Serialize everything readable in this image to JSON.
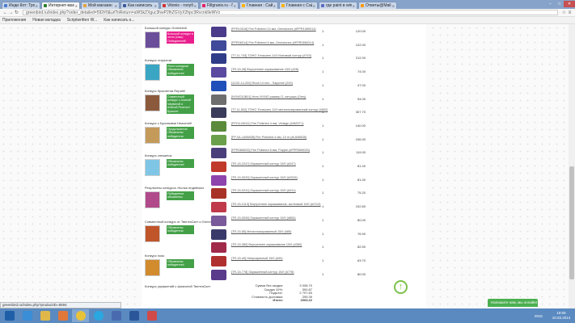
{
  "browser": {
    "tabs": [
      {
        "title": "Инди Кот: Тро",
        "color": "#4a7bd0",
        "active": false
      },
      {
        "title": "Интернет-магаз",
        "color": "#2e7d32",
        "active": true
      },
      {
        "title": "Мой магазин",
        "color": "#e6a23c",
        "active": false
      },
      {
        "title": "Как написать по",
        "color": "#3b5998",
        "active": false
      },
      {
        "title": "Vitonis - голубое",
        "color": "#d32f2f",
        "active": false
      },
      {
        "title": "Fillgranis.ru - Прог",
        "color": "#e91e63",
        "active": false
      },
      {
        "title": "Главная : Сайт ма",
        "color": "#ffb300",
        "active": false
      },
      {
        "title": "Главная с Сайт ма",
        "color": "#ffb300",
        "active": false
      },
      {
        "title": "где paint в windo",
        "color": "#5c6bc0",
        "active": false
      },
      {
        "title": "Ответы@Mail.Ru",
        "color": "#ff9800",
        "active": false
      }
    ],
    "url": "greenbird.ru/index.php?order_detailed=592#0&urlToReturn=aWSkZXguc3hwP2lhZGVyX2hpc3Rvcnk9eWVz",
    "bookmarks": [
      "Приложения",
      "Новая вкладка",
      "Scriptwritten W...",
      "Как написать к..."
    ],
    "status_url": "greenbird.ru/index.php?productID=8594"
  },
  "contests": [
    {
      "title": "Большой конкурс Greenbird!",
      "badge": "Большой конкурс в честь (наш) Победителей!",
      "badge_color": "#e91e8c",
      "thumb_color": "#6b4e9a"
    },
    {
      "title": "Конкурс открыток!",
      "badge": "Итоги конкурса! Объявлены победители!",
      "badge_color": "#43a047",
      "thumb_color": "#3aa6c4"
    },
    {
      "title": "Конкурс браслетов Repalit!",
      "badge": "Совместный конкурс с Алиной Червиной и Алёной Ресетко! Браслет",
      "badge_color": "#43a047",
      "thumb_color": "#8b5a3c"
    },
    {
      "title": "Конкурс с Бусинками Heavenet!",
      "badge": "Продолжается! Объявлены победители",
      "badge_color": "#43a047",
      "thumb_color": "#c49a5b"
    },
    {
      "title": "Конкурс снежинок",
      "badge": "Объявлены победители!",
      "badge_color": "#43a047",
      "thumb_color": "#7fc6e6"
    },
    {
      "title": "Результаты конкурса «Колье индейских женщин»",
      "badge": "Победители объявлены",
      "badge_color": "#43a047",
      "thumb_color": "#b04a8a"
    },
    {
      "title": "Совместный конкурс от ТвентаСкет и Greenbird",
      "badge": "Объявлены победители",
      "badge_color": "#43a047",
      "thumb_color": "#c0552a"
    },
    {
      "title": "Конкурс пояс",
      "badge": "Объявлены победители!",
      "badge_color": "#43a047",
      "thumb_color": "#d28b2d"
    },
    {
      "title": "Конкурс украшений с фазеоной ТвентаСкет",
      "badge": "",
      "badge_color": "#43a047",
      "thumb_color": "#999999"
    }
  ],
  "items": [
    {
      "name": "[FPR10016] Fire Polished 10 мм, Gemstones (#FPR1080014)",
      "qty": "1",
      "price": "120.00",
      "color": "#4b3b8a"
    },
    {
      "name": "[FPR06014] Fire Polished 6 мм, Gemstones (#FPR06MG14)",
      "qty": "1",
      "price": "122.00",
      "color": "#3f4a9a"
    },
    {
      "name": "[TT-11-743] TOHO Treasures 11/0 Матовый контур (#743)",
      "qty": "1",
      "price": "212.00",
      "color": "#2f3c88"
    },
    {
      "name": "[TR-15-28] Внутреннее окрашивание 15/0 (#28)",
      "qty": "1",
      "price": "74.00",
      "color": "#5b4aa0"
    },
    {
      "name": "[11/20-14-200] Rivoli 14 mm - Sapphire (200)",
      "qty": "1",
      "price": "47.00",
      "color": "#1f4fb8"
    },
    {
      "name": "[NYMO10B01] Нить NYMO размер D, катушка (Grey)",
      "qty": "1",
      "price": "94.00",
      "color": "#6e6e6e"
    },
    {
      "name": "[TT-11-502] TOHO Treasures 11/0 металлизированный контур (#502)",
      "qty": "1",
      "price": "307.70",
      "color": "#3b3b5a"
    },
    {
      "name": "[FPO4-06011] Fire Polished 4 мм, Vintage (#4MOT1)",
      "qty": "1",
      "price": "140.00",
      "color": "#5a8a3a"
    },
    {
      "name": "[FP-04-LA06838] Fire Polished 4 мм, 10 m (#LA06838)",
      "qty": "1",
      "price": "106.00",
      "color": "#6aa04a"
    },
    {
      "name": "[FPR06M020] Fire Polished 6 мм, Pupple (#FPR06M020)",
      "qty": "1",
      "price": "119.00",
      "color": "#4a3f7a"
    },
    {
      "name": "[TR-15-2247] Окрашенный контур 15/0 (#247)",
      "qty": "1",
      "price": "81.40",
      "color": "#c0392b"
    },
    {
      "name": "[TR-15-0020] Окрашенный контур 15/0 (#2026)",
      "qty": "1",
      "price": "81.40",
      "color": "#8e44ad"
    },
    {
      "name": "[TR-15-0241] Окрашенный контур 15/0 (#241)",
      "qty": "1",
      "price": "75.20",
      "color": "#a93226"
    },
    {
      "name": "[TR-15-2113] Внутреннее окрашивание, желтовый 15/0 (#2113)",
      "qty": "1",
      "price": "102.60",
      "color": "#c0394a"
    },
    {
      "name": "[TR-15-0034] Окрашенный контур 15/0 (#854)",
      "qty": "1",
      "price": "80.00",
      "color": "#7a5a9a"
    },
    {
      "name": "[TR-15-85] Металлизированный 15/0 (#85)",
      "qty": "1",
      "price": "76.90",
      "color": "#3a3a6a"
    },
    {
      "name": "[TR-15-380] Внутреннее окрашивание 15/0 (#380)",
      "qty": "1",
      "price": "82.50",
      "color": "#a02a4a"
    },
    {
      "name": "[TR-15-40] Непрозрачный 15/0 (#40)",
      "qty": "1",
      "price": "63.70",
      "color": "#b03030"
    },
    {
      "name": "[TR-15-778] Окрашенный контур 15/0 (#778)",
      "qty": "1",
      "price": "80.00",
      "color": "#5a3a8a"
    }
  ],
  "totals": [
    {
      "label": "Сумма без скидки:",
      "value": "3 008.70",
      "bold": false
    },
    {
      "label": "Скидка 10%:",
      "value": "300.87",
      "bold": false
    },
    {
      "label": "Подытог:",
      "value": "2 707.83",
      "bold": false
    },
    {
      "label": "Стоимость доставки:",
      "value": "295.39",
      "bold": false
    },
    {
      "label": "Итого:",
      "value": "2003.22",
      "bold": true
    }
  ],
  "chat_label": "Напишите нам, мы онлайн!",
  "taskbar": {
    "lang": "ENG",
    "time": "19:06",
    "date": "10.03.2014"
  },
  "window_controls": {
    "minimize": "–",
    "maximize": "□",
    "close": "✕"
  }
}
